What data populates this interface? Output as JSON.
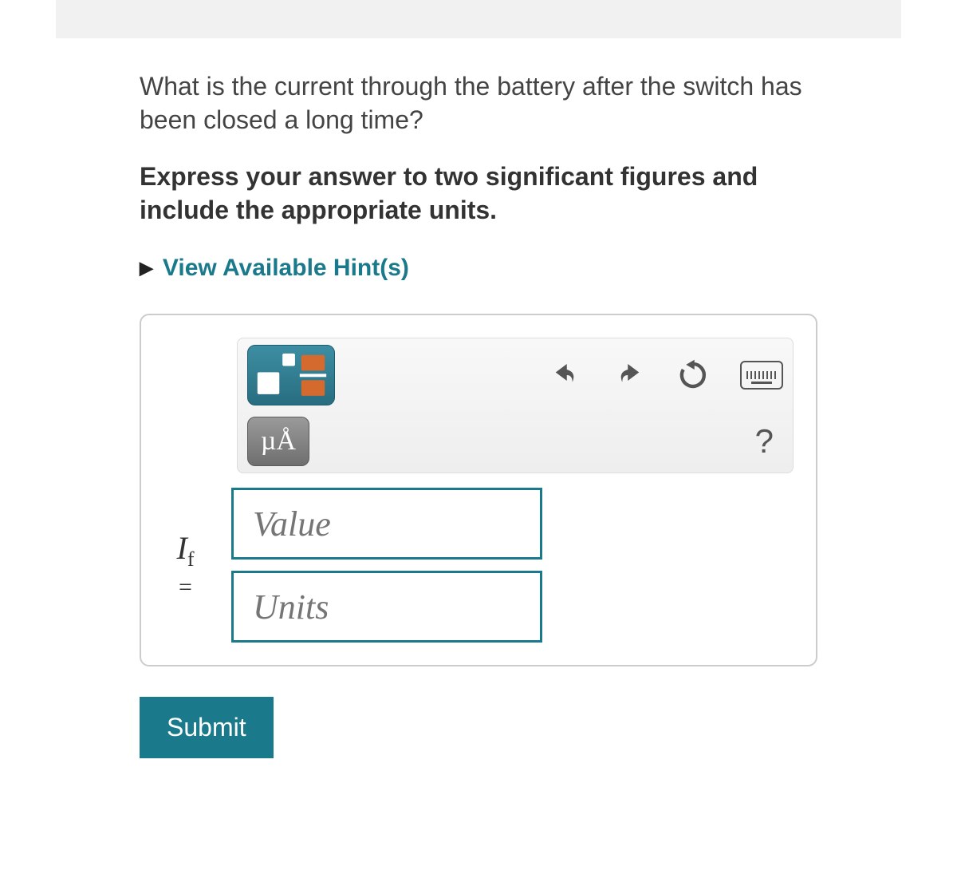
{
  "question": "What is the current through the battery after the switch has been closed a long time?",
  "instruction": "Express your answer to two significant figures and include the appropriate units.",
  "hints_label": "View Available Hint(s)",
  "toolbar": {
    "special_chars": "µÅ",
    "help": "?"
  },
  "answer": {
    "variable": "I",
    "subscript": "f",
    "equals": "=",
    "value_placeholder": "Value",
    "units_placeholder": "Units"
  },
  "submit_label": "Submit"
}
